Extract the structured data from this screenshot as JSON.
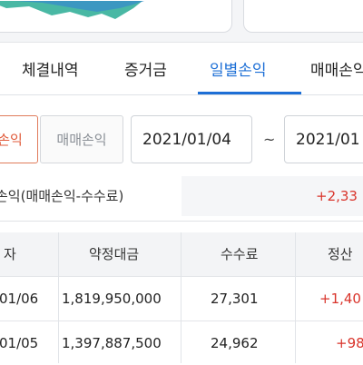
{
  "tabs": [
    {
      "label": "체결내역",
      "active": false
    },
    {
      "label": "증거금",
      "active": false
    },
    {
      "label": "일별손익",
      "active": true
    },
    {
      "label": "매매손익",
      "active": false
    }
  ],
  "filter": {
    "segments": [
      {
        "label": "손익",
        "selected": true
      },
      {
        "label": "매매손익",
        "selected": false
      }
    ],
    "start_date": "2021/01/04",
    "separator": "~",
    "end_date": "2021/01"
  },
  "summary": {
    "label": "손익(매매손익-수수료)",
    "value": "+2,33"
  },
  "table": {
    "headers": [
      "자",
      "약정대금",
      "수수료",
      "정산"
    ],
    "rows": [
      [
        "01/06",
        "1,819,950,000",
        "27,301",
        "+1,40"
      ],
      [
        "01/05",
        "1,397,887,500",
        "24,962",
        "+98"
      ]
    ]
  },
  "colors": {
    "accent": "#1d6fd6",
    "positive": "#d9342b",
    "selected_segment": "#e05a3a"
  }
}
